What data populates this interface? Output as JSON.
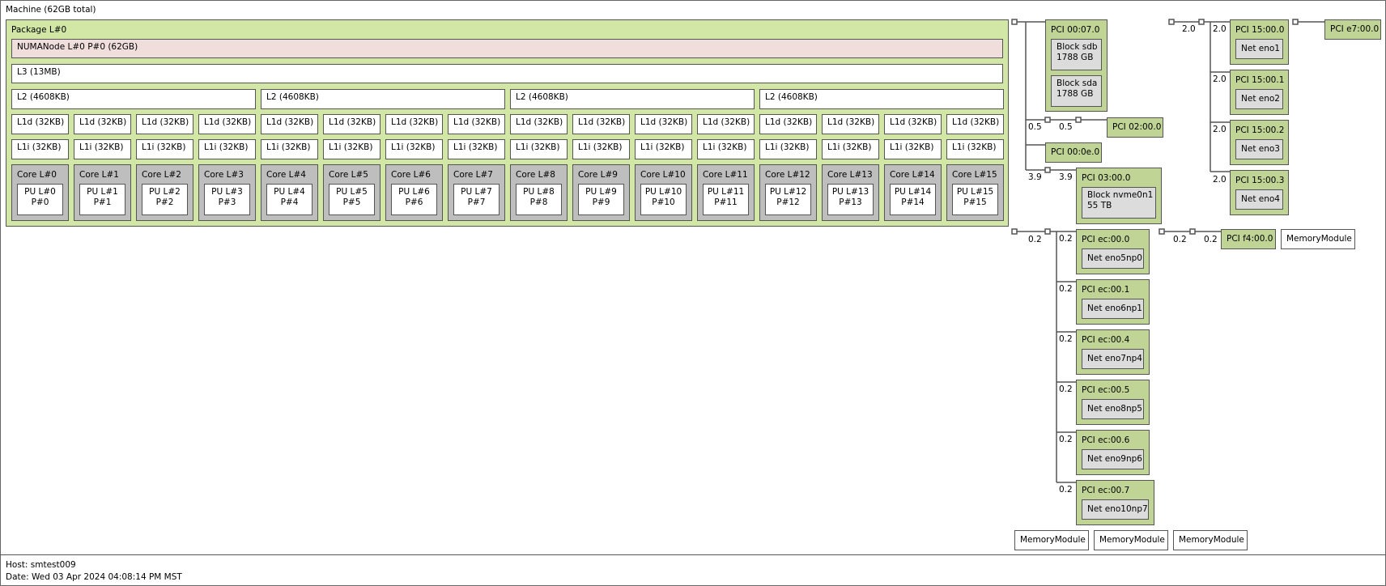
{
  "machine": {
    "label": "Machine (62GB total)"
  },
  "package": {
    "label": "Package L#0",
    "numa": "NUMANode L#0 P#0 (62GB)",
    "l3": "L3 (13MB)",
    "l2": [
      "L2 (4608KB)",
      "L2 (4608KB)",
      "L2 (4608KB)",
      "L2 (4608KB)"
    ],
    "l1d": "L1d (32KB)",
    "l1i": "L1i (32KB)",
    "cores": [
      [
        "Core L#0",
        "PU L#0",
        "P#0"
      ],
      [
        "Core L#1",
        "PU L#1",
        "P#1"
      ],
      [
        "Core L#2",
        "PU L#2",
        "P#2"
      ],
      [
        "Core L#3",
        "PU L#3",
        "P#3"
      ],
      [
        "Core L#4",
        "PU L#4",
        "P#4"
      ],
      [
        "Core L#5",
        "PU L#5",
        "P#5"
      ],
      [
        "Core L#6",
        "PU L#6",
        "P#6"
      ],
      [
        "Core L#7",
        "PU L#7",
        "P#7"
      ],
      [
        "Core L#8",
        "PU L#8",
        "P#8"
      ],
      [
        "Core L#9",
        "PU L#9",
        "P#9"
      ],
      [
        "Core L#10",
        "PU L#10",
        "P#10"
      ],
      [
        "Core L#11",
        "PU L#11",
        "P#11"
      ],
      [
        "Core L#12",
        "PU L#12",
        "P#12"
      ],
      [
        "Core L#13",
        "PU L#13",
        "P#13"
      ],
      [
        "Core L#14",
        "PU L#14",
        "P#14"
      ],
      [
        "Core L#15",
        "PU L#15",
        "P#15"
      ]
    ]
  },
  "pci": {
    "p0007": {
      "label": "PCI 00:07.0",
      "sdb": [
        "Block sdb",
        "1788 GB"
      ],
      "sda": [
        "Block sda",
        "1788 GB"
      ]
    },
    "p0200": {
      "label": "PCI 02:00.0",
      "bw": [
        "0.5",
        "0.5"
      ]
    },
    "p000e": {
      "label": "PCI 00:0e.0"
    },
    "p0300": {
      "label": "PCI 03:00.0",
      "bw": [
        "3.9",
        "3.9"
      ],
      "dev": [
        "Block nvme0n1",
        "55 TB"
      ]
    },
    "p15": {
      "bw": "2.0",
      "items": [
        [
          "PCI 15:00.0",
          "Net eno1",
          "2.0"
        ],
        [
          "PCI 15:00.1",
          "Net eno2",
          "2.0"
        ],
        [
          "PCI 15:00.2",
          "Net eno3",
          "2.0"
        ],
        [
          "PCI 15:00.3",
          "Net eno4",
          "2.0"
        ]
      ]
    },
    "pe7": {
      "label": "PCI e7:00.0"
    },
    "ec": {
      "bw": "0.2",
      "items": [
        [
          "PCI ec:00.0",
          "Net eno5np0",
          "0.2"
        ],
        [
          "PCI ec:00.1",
          "Net eno6np1",
          "0.2"
        ],
        [
          "PCI ec:00.4",
          "Net eno7np4",
          "0.2"
        ],
        [
          "PCI ec:00.5",
          "Net eno8np5",
          "0.2"
        ],
        [
          "PCI ec:00.6",
          "Net eno9np6",
          "0.2"
        ],
        [
          "PCI ec:00.7",
          "Net eno10np7",
          "0.2"
        ]
      ]
    },
    "pf4": {
      "label": "PCI f4:00.0",
      "bw": [
        "0.2",
        "0.2"
      ]
    }
  },
  "memory_modules": [
    "MemoryModule",
    "MemoryModule",
    "MemoryModule",
    "MemoryModule"
  ],
  "footer": {
    "host": "Host: smtest009",
    "date": "Date: Wed 03 Apr 2024 04:08:14 PM MST"
  }
}
